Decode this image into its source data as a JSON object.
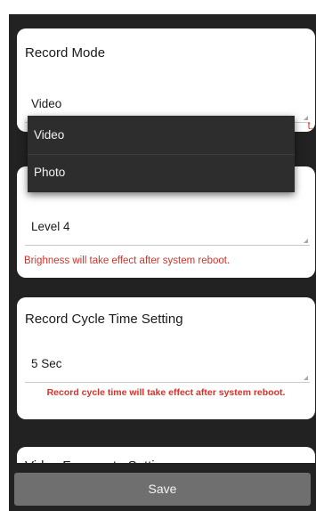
{
  "record_mode": {
    "title": "Record Mode",
    "value": "Video",
    "hint_tail": "t."
  },
  "mode_dropdown": {
    "options": [
      "Video",
      "Photo"
    ]
  },
  "brightness": {
    "value": "Level 4",
    "hint": "Brighness will take effect after system reboot."
  },
  "cycle_time": {
    "title": "Record Cycle Time Setting",
    "value": "5 Sec",
    "hint": "Record cycle time will take effect after system reboot."
  },
  "framerate": {
    "title": "Video Framerate Setting"
  },
  "footer": {
    "save_label": "Save"
  },
  "colors": {
    "background": "#222222",
    "card": "#ffffff",
    "hint_text": "#d2342d",
    "popup": "#2d2d2d",
    "save_button": "#6f6f6f"
  }
}
